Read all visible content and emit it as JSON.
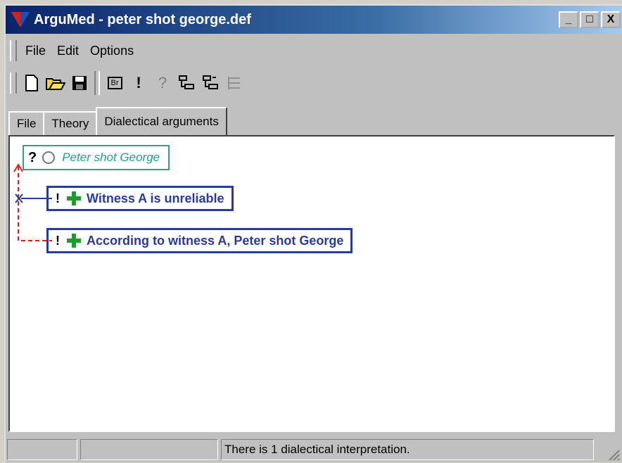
{
  "window": {
    "title": "ArguMed - peter shot george.def",
    "controls": [
      "_",
      "□",
      "X"
    ]
  },
  "menu": [
    {
      "label": "File"
    },
    {
      "label": "Edit"
    },
    {
      "label": "Options"
    }
  ],
  "toolbar": {
    "br_label": "Br",
    "bang": "!",
    "question": "?"
  },
  "tabs": [
    {
      "label": "File",
      "active": false
    },
    {
      "label": "Theory",
      "active": false
    },
    {
      "label": "Dialectical arguments",
      "active": true
    }
  ],
  "canvas": {
    "issue": {
      "marker": "?",
      "label": "Peter shot George"
    },
    "arguments": [
      {
        "marker": "!",
        "label": "Witness A is unreliable"
      },
      {
        "marker": "!",
        "label": "According to witness A, Peter shot George"
      }
    ],
    "colors": {
      "issue_border": "#30a090",
      "arg_border": "#2a3a9a",
      "plus": "#1e9a2e",
      "link": "#e02020"
    }
  },
  "status": {
    "panels": [
      "",
      ""
    ],
    "message": "There is 1 dialectical interpretation."
  }
}
